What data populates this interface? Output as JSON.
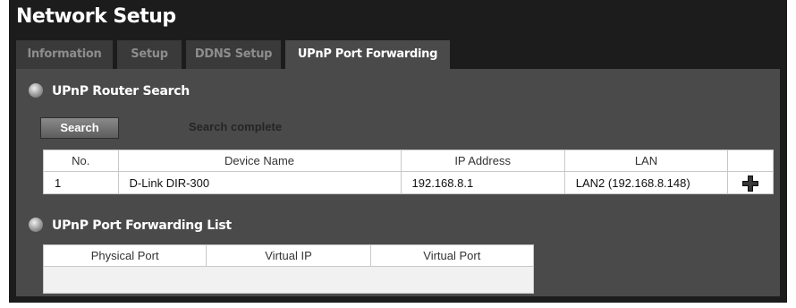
{
  "page": {
    "title": "Network Setup"
  },
  "tabs": [
    {
      "label": "Information",
      "active": false
    },
    {
      "label": "Setup",
      "active": false
    },
    {
      "label": "DDNS Setup",
      "active": false
    },
    {
      "label": "UPnP Port Forwarding",
      "active": true
    }
  ],
  "router_search": {
    "heading": "UPnP Router Search",
    "search_label": "Search",
    "status": "Search complete",
    "columns": [
      "No.",
      "Device Name",
      "IP Address",
      "LAN"
    ],
    "rows": [
      {
        "no": "1",
        "device": "D-Link DIR-300",
        "ip": "192.168.8.1",
        "lan": "LAN2 (192.168.8.148)",
        "action_icon": "add-icon"
      }
    ]
  },
  "port_forwarding": {
    "heading": "UPnP Port Forwarding List",
    "columns": [
      "Physical Port",
      "Virtual IP",
      "Virtual Port"
    ]
  },
  "colors": {
    "window_bg": "#1c1c1c",
    "panel_bg": "#4a4a4a",
    "tab_bg": "#3a3a3a",
    "active_tab_text": "#ffffff",
    "inactive_tab_text": "#8d8d8d"
  }
}
